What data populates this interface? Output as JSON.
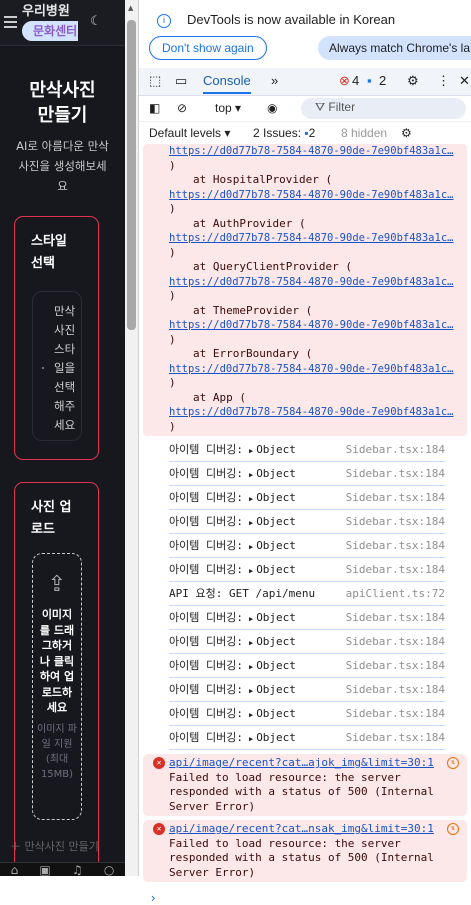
{
  "app": {
    "brand_line1": "우리병원",
    "brand_line2": "문화센터",
    "title": "만삭사진 만들기",
    "subtitle": "AI로 아름다운 만삭 사진을 생성해보세요",
    "style_card": {
      "heading": "스타일 선택",
      "placeholder": "만삭 사진 스타일을 선택해주세요"
    },
    "upload_card": {
      "heading": "사진 업로드",
      "drop_text": "이미지를 드래그하거나 클릭하여 업로드하세요",
      "hint": "이미지 파일 지원 (최대 15MB)"
    },
    "make_button": "만삭사진 만들기"
  },
  "devtools": {
    "notice": "DevTools is now available in Korean",
    "dont_show": "Don't show again",
    "always_match": "Always match Chrome's la",
    "tab": "Console",
    "error_count": "4",
    "info_count": "2",
    "context": "top",
    "filter_placeholder": "Filter",
    "levels": "Default levels",
    "issues_label": "2 Issues:",
    "issues_count": "2",
    "hidden": "8 hidden",
    "stack": {
      "url": "https://d0d77b78-7584-4870-90de-7e90bf483a1c…",
      "frames": [
        "at HospitalProvider (",
        "at AuthProvider (",
        "at QueryClientProvider (",
        "at ThemeProvider (",
        "at ErrorBoundary (",
        "at App ("
      ],
      "close": ")"
    },
    "logs": [
      {
        "msg": "아이템 디버깅:",
        "obj": "Object",
        "src": "Sidebar.tsx:184"
      },
      {
        "msg": "아이템 디버깅:",
        "obj": "Object",
        "src": "Sidebar.tsx:184"
      },
      {
        "msg": "아이템 디버깅:",
        "obj": "Object",
        "src": "Sidebar.tsx:184"
      },
      {
        "msg": "아이템 디버깅:",
        "obj": "Object",
        "src": "Sidebar.tsx:184"
      },
      {
        "msg": "아이템 디버깅:",
        "obj": "Object",
        "src": "Sidebar.tsx:184"
      },
      {
        "msg": "아이템 디버깅:",
        "obj": "Object",
        "src": "Sidebar.tsx:184"
      },
      {
        "msg": "API 요청: GET /api/menu",
        "obj": null,
        "src": "apiClient.ts:72"
      },
      {
        "msg": "아이템 디버깅:",
        "obj": "Object",
        "src": "Sidebar.tsx:184"
      },
      {
        "msg": "아이템 디버깅:",
        "obj": "Object",
        "src": "Sidebar.tsx:184"
      },
      {
        "msg": "아이템 디버깅:",
        "obj": "Object",
        "src": "Sidebar.tsx:184"
      },
      {
        "msg": "아이템 디버깅:",
        "obj": "Object",
        "src": "Sidebar.tsx:184"
      },
      {
        "msg": "아이템 디버깅:",
        "obj": "Object",
        "src": "Sidebar.tsx:184"
      },
      {
        "msg": "아이템 디버깅:",
        "obj": "Object",
        "src": "Sidebar.tsx:184"
      }
    ],
    "errors": [
      {
        "url": "api/image/recent?cat…ajok_img&limit=30:1",
        "msg": "Failed to load resource: the server responded with a status of 500 (Internal Server Error)"
      },
      {
        "url": "api/image/recent?cat…nsak_img&limit=30:1",
        "msg": "Failed to load resource: the server responded with a status of 500 (Internal Server Error)"
      }
    ]
  }
}
